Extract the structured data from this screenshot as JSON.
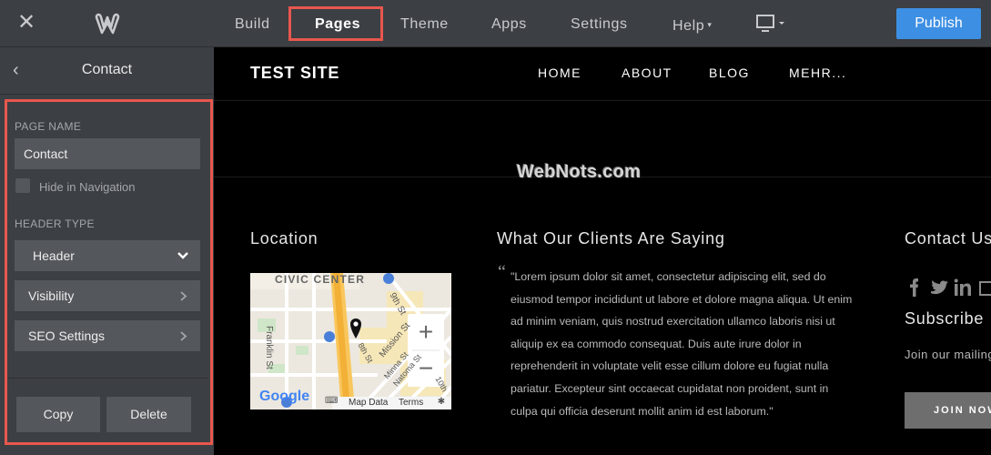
{
  "topbar": {
    "nav": [
      {
        "label": "Build"
      },
      {
        "label": "Pages"
      },
      {
        "label": "Theme"
      },
      {
        "label": "Apps"
      },
      {
        "label": "Settings"
      },
      {
        "label": "Help"
      }
    ],
    "publish_label": "Publish"
  },
  "panel": {
    "title": "Contact",
    "page_name_label": "PAGE NAME",
    "page_name_value": "Contact",
    "hide_nav_label": "Hide in Navigation",
    "header_type_label": "HEADER TYPE",
    "header_type_value": "Header",
    "visibility_label": "Visibility",
    "seo_label": "SEO Settings",
    "copy_label": "Copy",
    "delete_label": "Delete"
  },
  "site": {
    "title": "TEST SITE",
    "nav": [
      "HOME",
      "ABOUT",
      "BLOG",
      "MEHR..."
    ],
    "watermark": "WebNots.com",
    "location_heading": "Location",
    "clients_heading": "What Our Clients Are Saying",
    "contact_heading": "Contact Us",
    "quote_mark": "“",
    "quote": "\"Lorem ipsum dolor sit amet, consectetur adipiscing elit, sed do eiusmod tempor incididunt ut labore et dolore magna aliqua. Ut enim ad minim veniam, quis nostrud exercitation ullamco laboris nisi ut aliquip ex ea commodo consequat. Duis aute irure dolor in reprehenderit in voluptate velit esse cillum dolore eu fugiat nulla pariatur. Excepteur sint occaecat cupidatat non proident, sunt in culpa qui officia deserunt mollit anim id est laborum.\"",
    "subscribe_heading": "Subscribe",
    "join_text": "Join our mailing list",
    "join_button": "JOIN NOW",
    "map": {
      "district": "CIVIC CENTER",
      "street_1": "Franklin St",
      "street_2": "9th St",
      "street_3": "Mission St",
      "street_4": "Minna St",
      "street_5": "Natoma St",
      "street_6": "8th St",
      "street_7": "10th",
      "zoom_in": "+",
      "zoom_out": "−",
      "google_logo": "Google",
      "map_data": "Map Data",
      "terms": "Terms"
    }
  },
  "colors": {
    "accent_publish": "#3d8fe3",
    "highlight": "#e8574e",
    "panel_bg": "#3c3f43"
  }
}
